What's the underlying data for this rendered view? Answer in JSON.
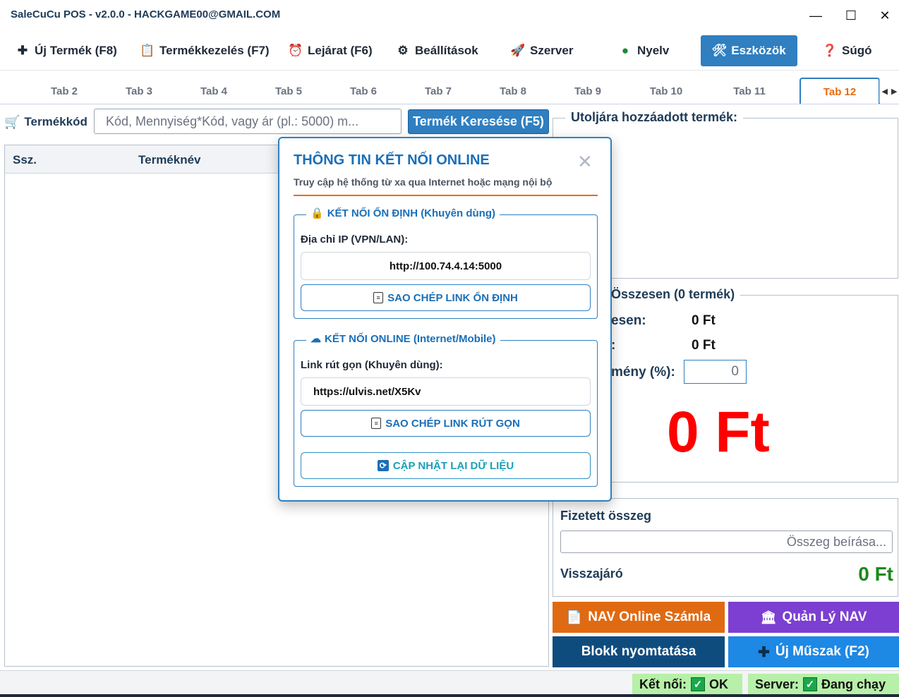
{
  "window": {
    "title": "SaleCuCu POS - v2.0.0 - HACKGAME00@GMAIL.COM",
    "controls": {
      "minimize": "—",
      "maximize": "☐",
      "close": "✕"
    }
  },
  "menu": {
    "items": [
      {
        "label": "Új Termék (F8)",
        "icon": "plus-icon",
        "glyph": "✚"
      },
      {
        "label": "Termékkezelés (F7)",
        "icon": "clipboard-icon",
        "glyph": "📋"
      },
      {
        "label": "Lejárat (F6)",
        "icon": "alarm-clock-icon",
        "glyph": "⏰"
      },
      {
        "label": "Beállítások",
        "icon": "gear-icon",
        "glyph": "⚙"
      },
      {
        "label": "Szerver",
        "icon": "rocket-icon",
        "glyph": "🚀"
      },
      {
        "label": "Nyelv",
        "icon": "globe-icon",
        "glyph": "●"
      },
      {
        "label": "Eszközök",
        "icon": "tools-icon",
        "glyph": "🛠",
        "active": true
      },
      {
        "label": "Súgó",
        "icon": "question-icon",
        "glyph": "❓"
      }
    ]
  },
  "tabs": {
    "items": [
      "Tab 2",
      "Tab 3",
      "Tab 4",
      "Tab 5",
      "Tab 6",
      "Tab 7",
      "Tab 8",
      "Tab 9",
      "Tab 10",
      "Tab 11",
      "Tab 12"
    ],
    "selected": "Tab 12",
    "scroll_left": "◀",
    "scroll_right": "▶"
  },
  "search": {
    "label": "Termékkód",
    "placeholder": "Kód, Mennyiség*Kód, vagy ár (pl.: 5000) m...",
    "button": "Termék Keresése (F5)"
  },
  "table": {
    "columns": [
      "Ssz.",
      "Terméknév"
    ],
    "rows": []
  },
  "last_added": {
    "title": "Utoljára hozzáadott termék:"
  },
  "summary": {
    "title": "Összesen (0 termék)",
    "row1_label": "esen:",
    "row1_value": "0 Ft",
    "row2_label": ":",
    "row2_value": "0 Ft",
    "discount_label": "mény (%):",
    "discount_value": "0",
    "grand_total": "0 Ft"
  },
  "payment": {
    "paid_label": "Fizetett összeg",
    "paid_placeholder": "Összeg beírása...",
    "change_label": "Visszajáró",
    "change_value": "0 Ft"
  },
  "actions": {
    "nav_invoice": "NAV Online Számla",
    "nav_manage": "Quản Lý NAV",
    "print": "Blokk nyomtatása",
    "new_shift": "Új Műszak (F2)"
  },
  "status": {
    "connection_label": "Kết nối:",
    "connection_value": "OK",
    "server_label": "Server:",
    "server_value": "Đang chạy"
  },
  "modal": {
    "title": "THÔNG TIN KẾT NỐI ONLINE",
    "subtitle": "Truy cập hệ thống từ xa qua Internet hoặc mạng nội bộ",
    "close": "✕",
    "stable": {
      "legend": "KẾT NỐI ỔN ĐỊNH (Khuyên dùng)",
      "ip_label": "Địa chỉ IP (VPN/LAN):",
      "ip_value": "http://100.74.4.14:5000",
      "copy_button": "SAO CHÉP LINK ỔN ĐỊNH"
    },
    "online": {
      "legend": "KẾT NỐI ONLINE (Internet/Mobile)",
      "short_label": "Link rút gọn (Khuyên dùng):",
      "short_value": "https://ulvis.net/X5Kv",
      "copy_button": "SAO CHÉP LINK RÚT GỌN",
      "refresh_button": "CẬP NHẬT LẠI DỮ LIỆU"
    }
  },
  "colors": {
    "accent": "#2f7fc1",
    "tab_selected": "#e86a10",
    "total_red": "#ff0000",
    "change_green": "#1a8a1a",
    "nav_orange": "#e06a12",
    "nav_purple": "#7c3fd1",
    "print_navy": "#0f4c7e",
    "shift_blue": "#1e88e5",
    "status_green": "#b7f0a8"
  }
}
